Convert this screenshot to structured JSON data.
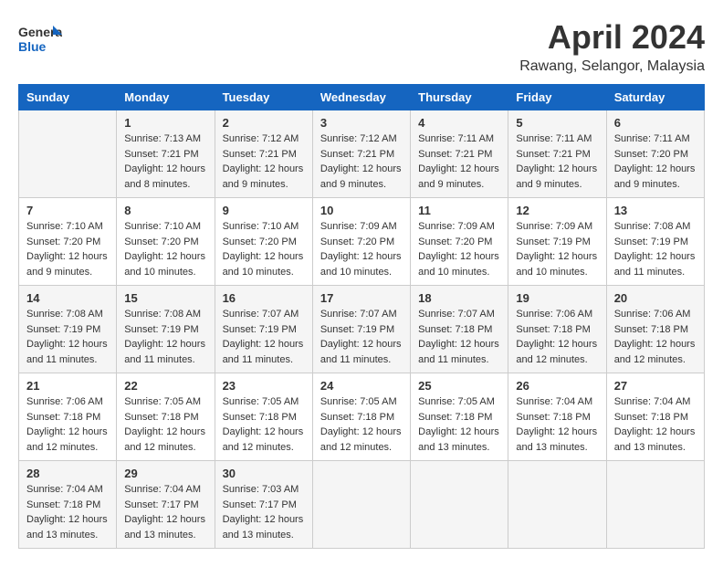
{
  "header": {
    "logo_general": "General",
    "logo_blue": "Blue",
    "month": "April 2024",
    "location": "Rawang, Selangor, Malaysia"
  },
  "days_of_week": [
    "Sunday",
    "Monday",
    "Tuesday",
    "Wednesday",
    "Thursday",
    "Friday",
    "Saturday"
  ],
  "weeks": [
    [
      {
        "day": "",
        "info": ""
      },
      {
        "day": "1",
        "info": "Sunrise: 7:13 AM\nSunset: 7:21 PM\nDaylight: 12 hours\nand 8 minutes."
      },
      {
        "day": "2",
        "info": "Sunrise: 7:12 AM\nSunset: 7:21 PM\nDaylight: 12 hours\nand 9 minutes."
      },
      {
        "day": "3",
        "info": "Sunrise: 7:12 AM\nSunset: 7:21 PM\nDaylight: 12 hours\nand 9 minutes."
      },
      {
        "day": "4",
        "info": "Sunrise: 7:11 AM\nSunset: 7:21 PM\nDaylight: 12 hours\nand 9 minutes."
      },
      {
        "day": "5",
        "info": "Sunrise: 7:11 AM\nSunset: 7:21 PM\nDaylight: 12 hours\nand 9 minutes."
      },
      {
        "day": "6",
        "info": "Sunrise: 7:11 AM\nSunset: 7:20 PM\nDaylight: 12 hours\nand 9 minutes."
      }
    ],
    [
      {
        "day": "7",
        "info": "Sunrise: 7:10 AM\nSunset: 7:20 PM\nDaylight: 12 hours\nand 9 minutes."
      },
      {
        "day": "8",
        "info": "Sunrise: 7:10 AM\nSunset: 7:20 PM\nDaylight: 12 hours\nand 10 minutes."
      },
      {
        "day": "9",
        "info": "Sunrise: 7:10 AM\nSunset: 7:20 PM\nDaylight: 12 hours\nand 10 minutes."
      },
      {
        "day": "10",
        "info": "Sunrise: 7:09 AM\nSunset: 7:20 PM\nDaylight: 12 hours\nand 10 minutes."
      },
      {
        "day": "11",
        "info": "Sunrise: 7:09 AM\nSunset: 7:20 PM\nDaylight: 12 hours\nand 10 minutes."
      },
      {
        "day": "12",
        "info": "Sunrise: 7:09 AM\nSunset: 7:19 PM\nDaylight: 12 hours\nand 10 minutes."
      },
      {
        "day": "13",
        "info": "Sunrise: 7:08 AM\nSunset: 7:19 PM\nDaylight: 12 hours\nand 11 minutes."
      }
    ],
    [
      {
        "day": "14",
        "info": "Sunrise: 7:08 AM\nSunset: 7:19 PM\nDaylight: 12 hours\nand 11 minutes."
      },
      {
        "day": "15",
        "info": "Sunrise: 7:08 AM\nSunset: 7:19 PM\nDaylight: 12 hours\nand 11 minutes."
      },
      {
        "day": "16",
        "info": "Sunrise: 7:07 AM\nSunset: 7:19 PM\nDaylight: 12 hours\nand 11 minutes."
      },
      {
        "day": "17",
        "info": "Sunrise: 7:07 AM\nSunset: 7:19 PM\nDaylight: 12 hours\nand 11 minutes."
      },
      {
        "day": "18",
        "info": "Sunrise: 7:07 AM\nSunset: 7:18 PM\nDaylight: 12 hours\nand 11 minutes."
      },
      {
        "day": "19",
        "info": "Sunrise: 7:06 AM\nSunset: 7:18 PM\nDaylight: 12 hours\nand 12 minutes."
      },
      {
        "day": "20",
        "info": "Sunrise: 7:06 AM\nSunset: 7:18 PM\nDaylight: 12 hours\nand 12 minutes."
      }
    ],
    [
      {
        "day": "21",
        "info": "Sunrise: 7:06 AM\nSunset: 7:18 PM\nDaylight: 12 hours\nand 12 minutes."
      },
      {
        "day": "22",
        "info": "Sunrise: 7:05 AM\nSunset: 7:18 PM\nDaylight: 12 hours\nand 12 minutes."
      },
      {
        "day": "23",
        "info": "Sunrise: 7:05 AM\nSunset: 7:18 PM\nDaylight: 12 hours\nand 12 minutes."
      },
      {
        "day": "24",
        "info": "Sunrise: 7:05 AM\nSunset: 7:18 PM\nDaylight: 12 hours\nand 12 minutes."
      },
      {
        "day": "25",
        "info": "Sunrise: 7:05 AM\nSunset: 7:18 PM\nDaylight: 12 hours\nand 13 minutes."
      },
      {
        "day": "26",
        "info": "Sunrise: 7:04 AM\nSunset: 7:18 PM\nDaylight: 12 hours\nand 13 minutes."
      },
      {
        "day": "27",
        "info": "Sunrise: 7:04 AM\nSunset: 7:18 PM\nDaylight: 12 hours\nand 13 minutes."
      }
    ],
    [
      {
        "day": "28",
        "info": "Sunrise: 7:04 AM\nSunset: 7:18 PM\nDaylight: 12 hours\nand 13 minutes."
      },
      {
        "day": "29",
        "info": "Sunrise: 7:04 AM\nSunset: 7:17 PM\nDaylight: 12 hours\nand 13 minutes."
      },
      {
        "day": "30",
        "info": "Sunrise: 7:03 AM\nSunset: 7:17 PM\nDaylight: 12 hours\nand 13 minutes."
      },
      {
        "day": "",
        "info": ""
      },
      {
        "day": "",
        "info": ""
      },
      {
        "day": "",
        "info": ""
      },
      {
        "day": "",
        "info": ""
      }
    ]
  ]
}
